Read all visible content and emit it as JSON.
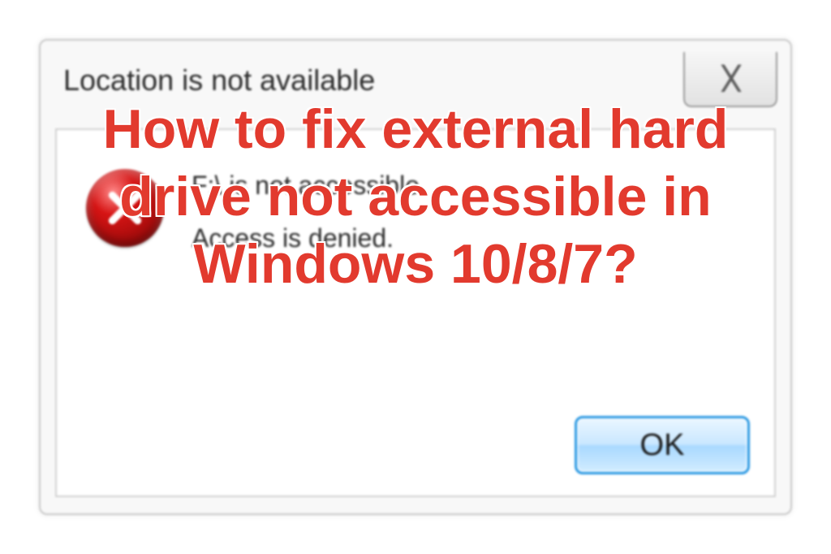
{
  "dialog": {
    "title": "Location is not available",
    "close_glyph": "✕",
    "message_line1": "F:\\ is not accessible.",
    "message_line2": "Access is denied.",
    "ok_label": "OK"
  },
  "overlay": {
    "headline": "How to fix external hard drive not accessible in Windows 10/8/7?"
  },
  "colors": {
    "overlay_text": "#e23a2e",
    "ok_border": "#2a98e2"
  }
}
